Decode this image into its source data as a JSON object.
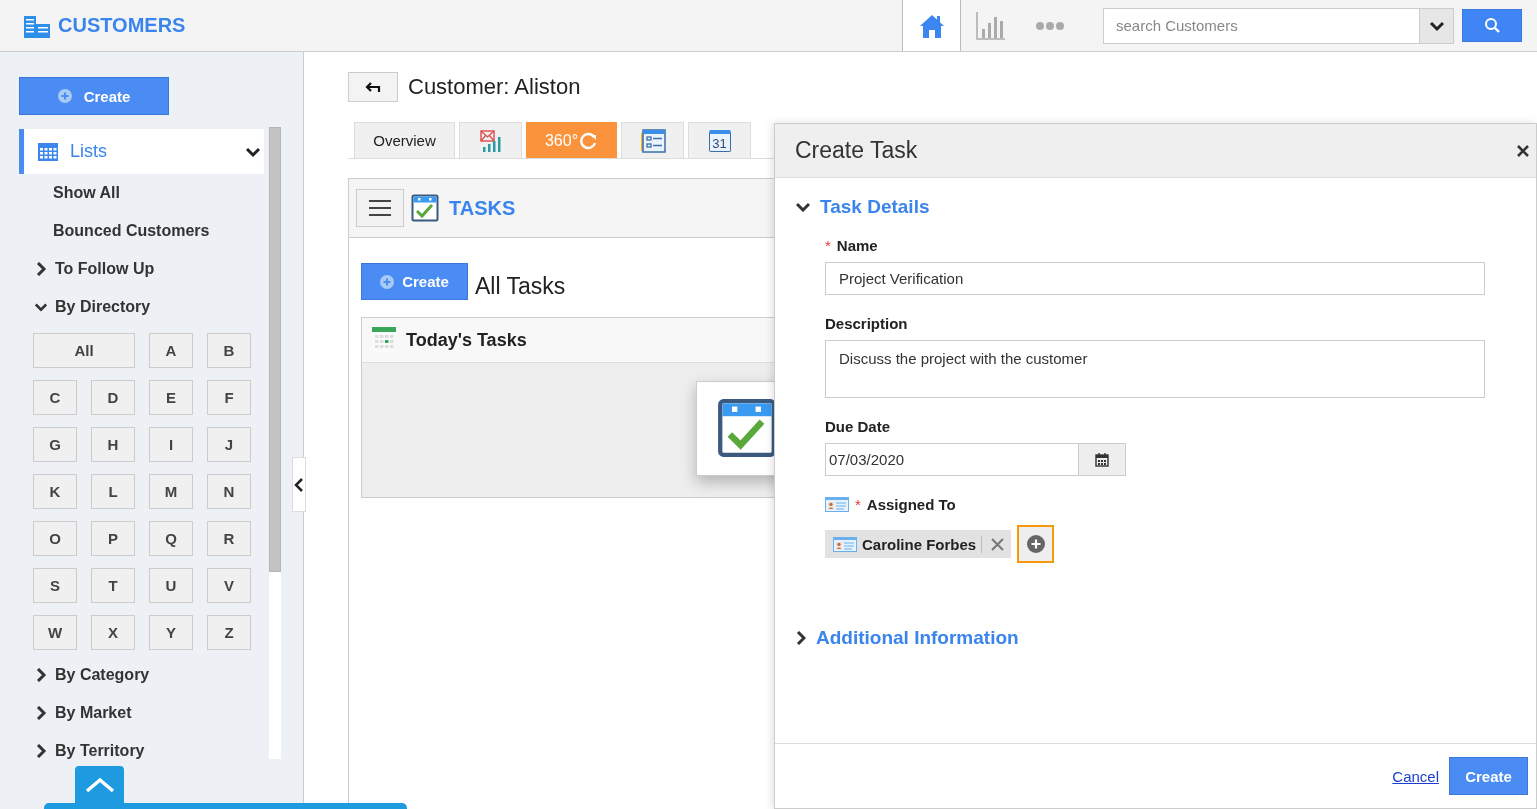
{
  "app": {
    "title": "CUSTOMERS"
  },
  "header_nav": [
    {
      "kind": "home",
      "selected": true
    },
    {
      "kind": "chart",
      "selected": false
    },
    {
      "kind": "more",
      "selected": false
    }
  ],
  "search": {
    "placeholder": "search Customers"
  },
  "sidebar": {
    "create_button": "Create",
    "lists": {
      "label": "Lists",
      "selected": true,
      "expanded": true
    },
    "items": [
      {
        "kind": "link",
        "label": "Show All"
      },
      {
        "kind": "link",
        "label": "Bounced Customers"
      },
      {
        "kind": "group",
        "label": "To Follow Up",
        "expanded": false
      },
      {
        "kind": "group",
        "label": "By Directory",
        "expanded": true,
        "letters": [
          "All",
          "A",
          "B",
          "C",
          "D",
          "E",
          "F",
          "G",
          "H",
          "I",
          "J",
          "K",
          "L",
          "M",
          "N",
          "O",
          "P",
          "Q",
          "R",
          "S",
          "T",
          "U",
          "V",
          "W",
          "X",
          "Y",
          "Z"
        ]
      },
      {
        "kind": "group",
        "label": "By Category",
        "expanded": false
      },
      {
        "kind": "group",
        "label": "By Market",
        "expanded": false
      },
      {
        "kind": "group",
        "label": "By Territory",
        "expanded": false
      }
    ]
  },
  "record": {
    "title": "Customer: Aliston"
  },
  "tabs": [
    {
      "kind": "text",
      "label": "Overview",
      "selected": false
    },
    {
      "kind": "mail-stats",
      "selected": false
    },
    {
      "kind": "rotate",
      "label": "360°",
      "selected": true
    },
    {
      "kind": "form",
      "selected": false
    },
    {
      "kind": "calendar",
      "label": "31",
      "selected": false
    }
  ],
  "tasks": {
    "title": "TASKS",
    "create_button": "Create",
    "list_title": "All Tasks",
    "section_title": "Today's Tasks"
  },
  "dialog": {
    "title": "Create Task",
    "sections": [
      {
        "title": "Task Details",
        "expanded": true,
        "fields": [
          {
            "kind": "text",
            "label": "Name",
            "required_mark": "*",
            "value": "Project Verification"
          },
          {
            "kind": "textarea",
            "label": "Description",
            "value": "Discuss the project with the customer"
          },
          {
            "kind": "date",
            "label": "Due Date",
            "value": "07/03/2020"
          },
          {
            "kind": "assignee",
            "label": "Assigned To",
            "required_mark": "*",
            "chips": [
              {
                "label": "Caroline Forbes"
              }
            ],
            "add_focused": true
          }
        ]
      },
      {
        "title": "Additional Information",
        "expanded": false
      }
    ],
    "cancel": "Cancel",
    "submit": "Create"
  }
}
